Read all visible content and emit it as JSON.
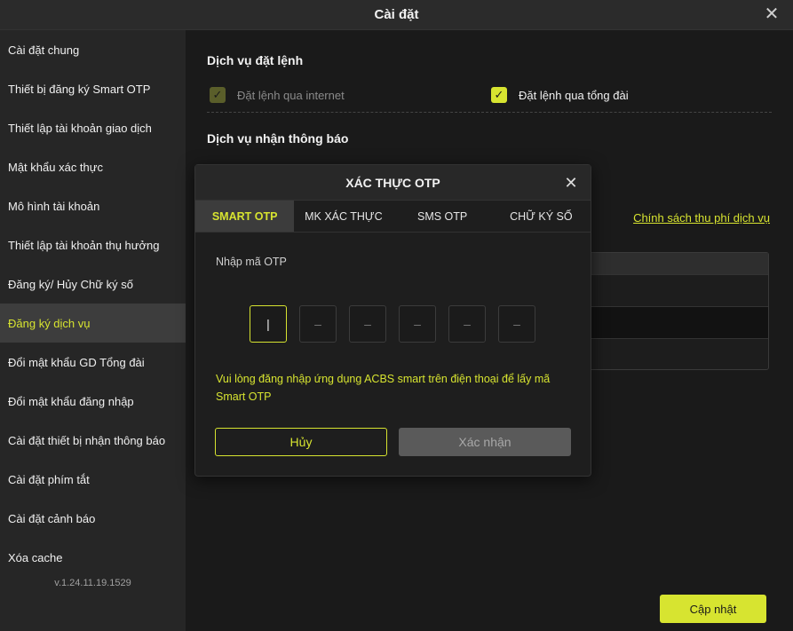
{
  "window": {
    "title": "Cài đặt"
  },
  "sidebar": {
    "items": [
      {
        "label": "Cài đặt chung"
      },
      {
        "label": "Thiết bị đăng ký Smart OTP"
      },
      {
        "label": "Thiết lập tài khoản giao dịch"
      },
      {
        "label": "Mật khẩu xác thực"
      },
      {
        "label": "Mô hình tài khoản"
      },
      {
        "label": "Thiết lập tài khoản thụ hưởng"
      },
      {
        "label": "Đăng ký/ Hủy Chữ ký số"
      },
      {
        "label": "Đăng ký dịch vụ"
      },
      {
        "label": "Đổi mật khẩu GD Tổng đài"
      },
      {
        "label": "Đổi mật khẩu đăng nhập"
      },
      {
        "label": "Cài đặt thiết bị nhận thông báo"
      },
      {
        "label": "Cài đặt phím tắt"
      },
      {
        "label": "Cài đặt cảnh báo"
      },
      {
        "label": "Xóa cache"
      }
    ],
    "active_index": 7,
    "version": "v.1.24.11.19.1529"
  },
  "main": {
    "order_service_title": "Dịch vụ đặt lệnh",
    "order_options": [
      {
        "label": "Đặt lệnh qua internet",
        "checked": true,
        "disabled": true
      },
      {
        "label": "Đặt lệnh qua tổng đài",
        "checked": true,
        "disabled": false
      }
    ],
    "notify_service_title": "Dịch vụ nhận thông báo",
    "policy_link": "Chính sách thu phí dịch vụ",
    "update_button": "Cập nhật"
  },
  "modal": {
    "title": "XÁC THỰC OTP",
    "tabs": [
      "SMART OTP",
      "MK XÁC THỰC",
      "SMS OTP",
      "CHỮ KÝ SỐ"
    ],
    "active_tab": 0,
    "otp_label": "Nhập mã OTP",
    "otp_digits": [
      "",
      "",
      "",
      "",
      "",
      ""
    ],
    "otp_placeholder": "–",
    "hint": "Vui lòng đăng nhập ứng dụng ACBS smart trên điện thoại để lấy mã Smart OTP",
    "cancel_button": "Hủy",
    "confirm_button": "Xác nhận"
  },
  "colors": {
    "accent": "#d7e430",
    "background": "#1a1a1a",
    "sidebar": "#262626",
    "active_item": "#3d3d3d"
  }
}
